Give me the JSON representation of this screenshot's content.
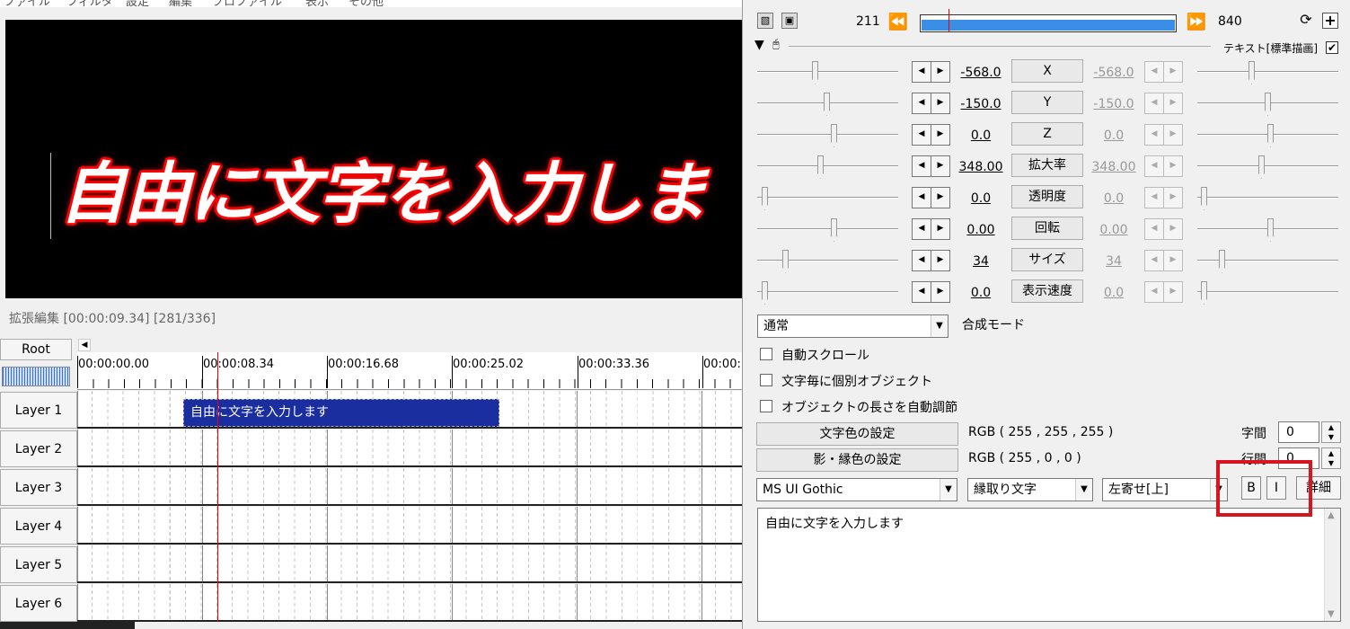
{
  "menu": {
    "items": [
      "ファイル",
      "フィルタ",
      "設定",
      "編集",
      "プロファイル",
      "表示",
      "その他"
    ]
  },
  "preview": {
    "text": "自由に文字を入力しま"
  },
  "timeline": {
    "title": "拡張編集 [00:00:09.34] [281/336]",
    "root_label": "Root",
    "ruler_labels": [
      "00:00:00.00",
      "00:00:08.34",
      "00:00:16.68",
      "00:00:25.02",
      "00:00:33.36",
      "00:00:"
    ],
    "layers": [
      "Layer 1",
      "Layer 2",
      "Layer 3",
      "Layer 4",
      "Layer 5",
      "Layer 6"
    ],
    "clip_label": "自由に文字を入力します"
  },
  "panel": {
    "frame_start": "211",
    "frame_end": "840",
    "object_label": "テキスト[標準描画]",
    "object_enabled": true,
    "params": [
      {
        "name": "X",
        "value": "-568.0",
        "end": "-568.0"
      },
      {
        "name": "Y",
        "value": "-150.0",
        "end": "-150.0"
      },
      {
        "name": "Z",
        "value": "0.0",
        "end": "0.0"
      },
      {
        "name": "拡大率",
        "value": "348.00",
        "end": "348.00"
      },
      {
        "name": "透明度",
        "value": "0.0",
        "end": "0.0"
      },
      {
        "name": "回転",
        "value": "0.00",
        "end": "0.00"
      },
      {
        "name": "サイズ",
        "value": "34",
        "end": "34"
      },
      {
        "name": "表示速度",
        "value": "0.0",
        "end": "0.0"
      }
    ],
    "blend_mode": "通常",
    "blend_label": "合成モード",
    "checkboxes": [
      "自動スクロール",
      "文字毎に個別オブジェクト",
      "オブジェクトの長さを自動調節"
    ],
    "text_color_button": "文字色の設定",
    "text_color_value": "RGB ( 255 , 255 , 255 )",
    "shadow_color_button": "影・縁色の設定",
    "shadow_color_value": "RGB ( 255 , 0 , 0 )",
    "char_spacing_label": "字間",
    "char_spacing": "0",
    "line_spacing_label": "行間",
    "line_spacing": "0",
    "font": "MS UI Gothic",
    "decoration": "縁取り文字",
    "align": "左寄せ[上]",
    "bold_label": "B",
    "italic_label": "I",
    "detail_label": "詳細",
    "text_content": "自由に文字を入力します"
  },
  "colors": {
    "highlight": "#d8141e",
    "clip": "#1b2ea0",
    "playhead": "#e00000",
    "text_outline": "#ff0000"
  }
}
